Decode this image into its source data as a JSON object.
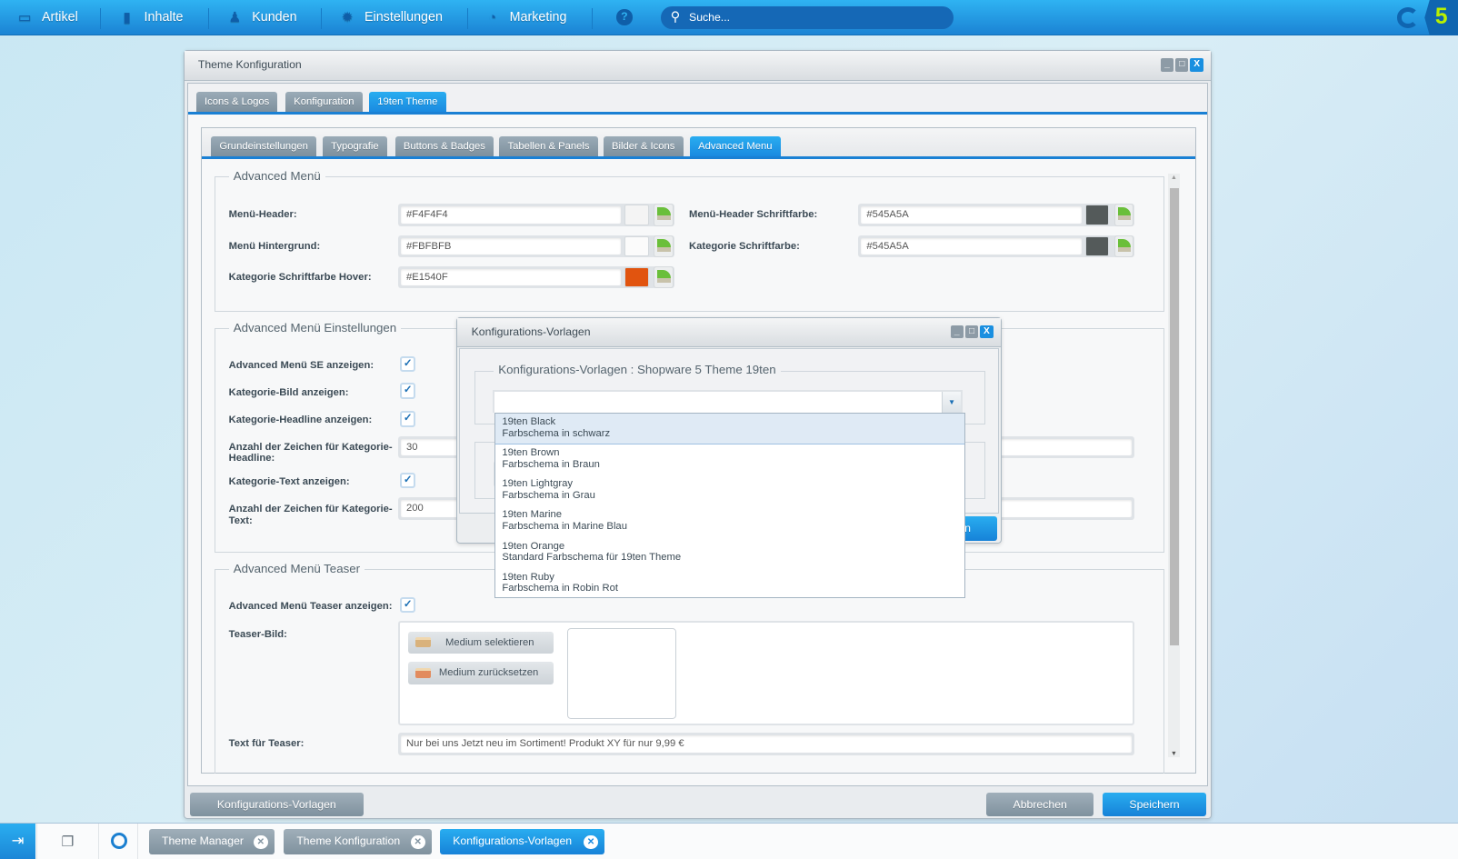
{
  "topbar": {
    "nav": [
      {
        "label": "Artikel",
        "icon": "inbox-icon"
      },
      {
        "label": "Inhalte",
        "icon": "document-icon"
      },
      {
        "label": "Kunden",
        "icon": "users-icon"
      },
      {
        "label": "Einstellungen",
        "icon": "gear-icon"
      },
      {
        "label": "Marketing",
        "icon": "pie-chart-icon"
      }
    ],
    "help_icon": "?",
    "search_placeholder": "Suche...",
    "logo_text": "5"
  },
  "main_window": {
    "title": "Theme Konfiguration",
    "tabs": [
      "Icons & Logos",
      "Konfiguration",
      "19ten Theme"
    ],
    "active_tab": "19ten Theme",
    "subtabs": [
      "Grundeinstellungen",
      "Typografie",
      "Buttons & Badges",
      "Tabellen & Panels",
      "Bilder & Icons",
      "Advanced Menu"
    ],
    "active_subtab": "Advanced Menu",
    "fieldset_menu": {
      "legend": "Advanced Menü",
      "fields": [
        {
          "label": "Menü-Header:",
          "value": "#F4F4F4",
          "color": "#F4F4F4"
        },
        {
          "label": "Menü Hintergrund:",
          "value": "#FBFBFB",
          "color": "#FBFBFB"
        },
        {
          "label": "Kategorie Schriftfarbe Hover:",
          "value": "#E1540F",
          "color": "#E1540F"
        },
        {
          "label": "Menü-Header Schriftfarbe:",
          "value": "#545A5A",
          "color": "#545A5A"
        },
        {
          "label": "Kategorie Schriftfarbe:",
          "value": "#545A5A",
          "color": "#545A5A"
        }
      ]
    },
    "fieldset_settings": {
      "legend": "Advanced Menü Einstellungen",
      "fields": [
        {
          "label": "Advanced Menü SE anzeigen:",
          "checked": true
        },
        {
          "label": "Kategorie-Bild anzeigen:",
          "checked": true
        },
        {
          "label": "Kategorie-Headline anzeigen:",
          "checked": true
        },
        {
          "label": "Anzahl der Zeichen für Kategorie-Headline:",
          "value": "30"
        },
        {
          "label": "Kategorie-Text anzeigen:",
          "checked": true
        },
        {
          "label": "Anzahl der Zeichen für Kategorie-Text:",
          "value": "200"
        }
      ]
    },
    "fieldset_teaser": {
      "legend": "Advanced Menü Teaser",
      "show_label": "Advanced Menü Teaser anzeigen:",
      "show_checked": true,
      "image_label": "Teaser-Bild:",
      "select_media": "Medium selektieren",
      "reset_media": "Medium zurücksetzen",
      "text_label": "Text für Teaser:",
      "text_value": "Nur bei uns Jetzt neu im Sortiment! Produkt XY für nur 9,99 €"
    },
    "footer": {
      "templates_button": "Konfigurations-Vorlagen",
      "cancel_button": "Abbrechen",
      "save_button": "Speichern"
    }
  },
  "modal": {
    "title": "Konfigurations-Vorlagen",
    "legend": "Konfigurations-Vorlagen : Shopware 5 Theme 19ten",
    "combo_value": "",
    "apply_button_visible_text": "n",
    "options": [
      {
        "name": "19ten Black",
        "desc": "Farbschema in schwarz",
        "highlighted": true
      },
      {
        "name": "19ten Brown",
        "desc": "Farbschema in Braun"
      },
      {
        "name": "19ten Lightgray",
        "desc": "Farbschema in Grau"
      },
      {
        "name": "19ten Marine",
        "desc": "Farbschema in Marine Blau"
      },
      {
        "name": "19ten Orange",
        "desc": "Standard Farbschema für 19ten Theme"
      },
      {
        "name": "19ten Ruby",
        "desc": "Farbschema in Robin Rot"
      }
    ]
  },
  "taskbar": {
    "items": [
      {
        "label": "Theme Manager",
        "active": false
      },
      {
        "label": "Theme Konfiguration",
        "active": false
      },
      {
        "label": "Konfigurations-Vorlagen",
        "active": true
      }
    ]
  },
  "colors": {
    "accent": "#1a8ae0",
    "logo_green": "#b9f000"
  }
}
